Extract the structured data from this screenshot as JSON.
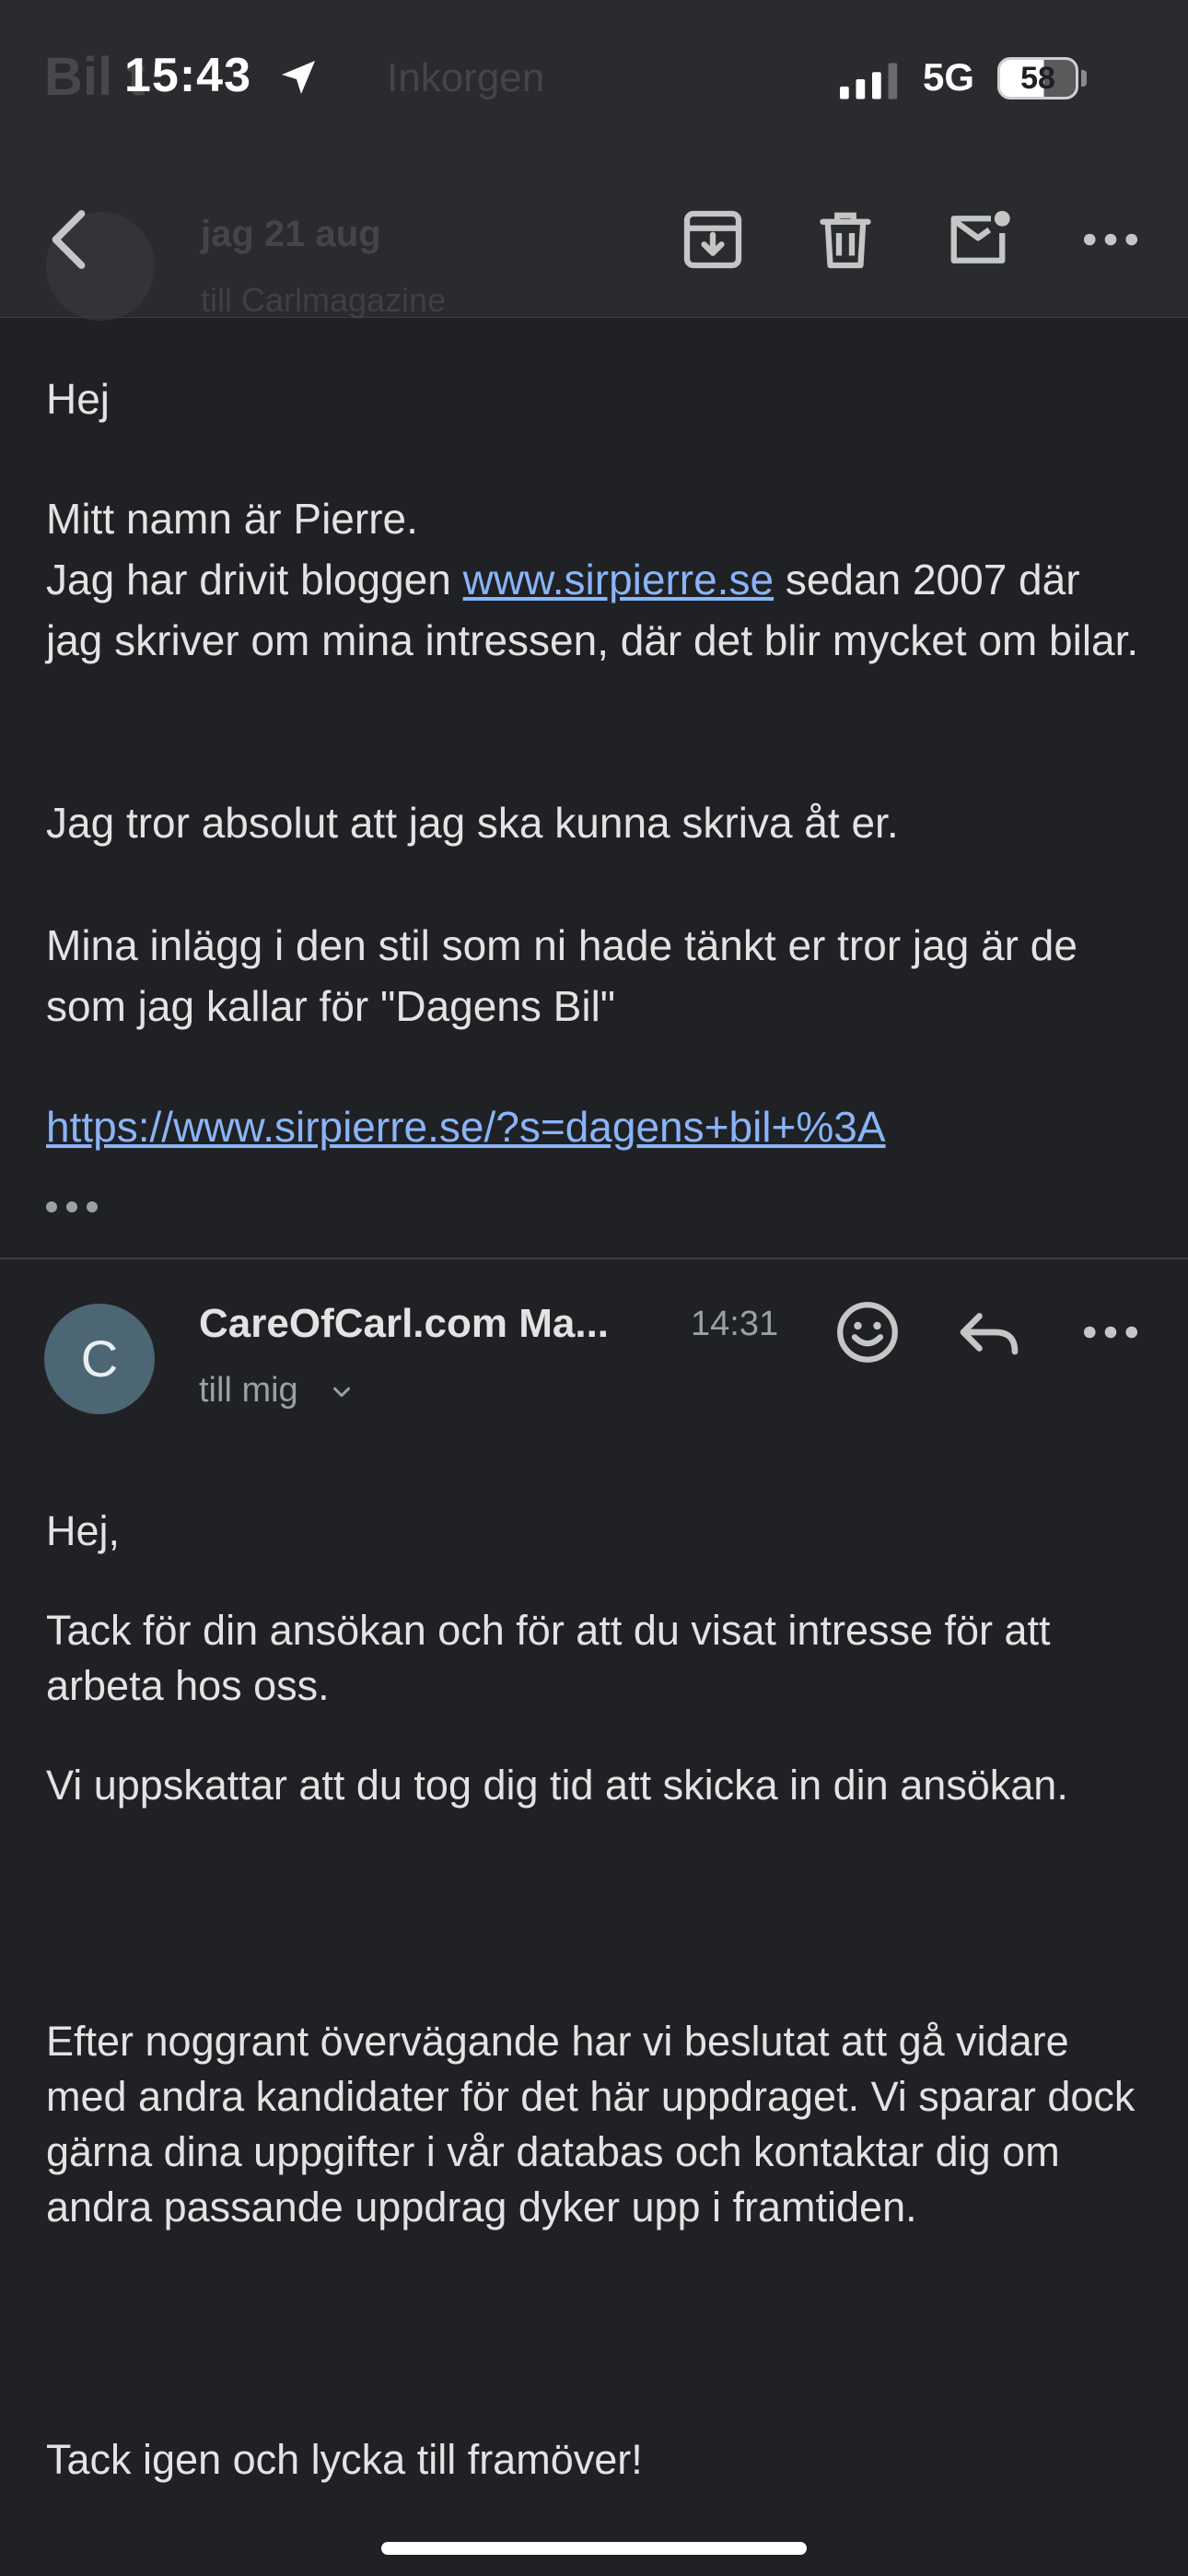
{
  "status_bar": {
    "time": "15:43",
    "network": "5G",
    "battery": "58"
  },
  "header_ghost": {
    "subject_fragment": "Bil          t",
    "label_chip": "Inkorgen",
    "sender": "jag   21 aug",
    "to": "till Carlmagazine"
  },
  "toolbar": {
    "icons": [
      "back-icon",
      "archive-icon",
      "delete-icon",
      "mark-unread-icon",
      "more-icon"
    ]
  },
  "message1": {
    "greeting": "Hej",
    "intro": "Mitt namn är Pierre.",
    "blog_prefix": "Jag har drivit bloggen ",
    "blog_link": "www.sirpierre.se",
    "blog_suffix": " sedan 2007 där jag skriver om mina intressen, där det blir mycket om bilar.",
    "p2": "Jag tror absolut att jag ska kunna skriva åt er.",
    "p3": "Mina inlägg i den stil som ni hade tänkt er tror jag är de som jag kallar för \"Dagens Bil\"",
    "link": "https://www.sirpierre.se/?s=dagens+bil+%3A"
  },
  "message2": {
    "avatar_letter": "C",
    "sender": "CareOfCarl.com Ma...",
    "time": "14:31",
    "recipient": "till mig",
    "greeting": "Hej,",
    "p1": "Tack för din ansökan och för att du visat intresse för att arbeta hos oss.",
    "p2": "Vi uppskattar att du tog dig tid att skicka in din ansökan.",
    "p3": "Efter noggrant övervägande har vi beslutat att gå vidare med andra kandidater för det här uppdraget. Vi sparar dock gärna dina uppgifter i vår databas och kontaktar dig om andra passande uppdrag dyker upp i framtiden.",
    "p4": "Tack igen och lycka till framöver!"
  },
  "colors": {
    "background": "#202124",
    "header": "#2a2b2e",
    "link": "#8ab4f8",
    "avatar": "#4c6673",
    "muted": "#9aa0a6"
  }
}
